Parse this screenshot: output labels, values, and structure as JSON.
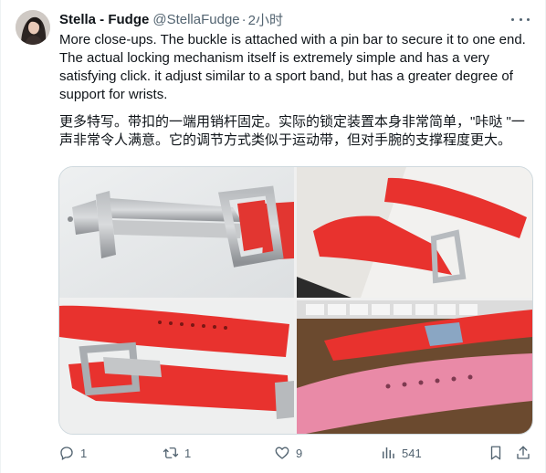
{
  "author": {
    "name": "Stella - Fudge",
    "handle": "@StellaFudge",
    "separator": "·",
    "time": "2小时"
  },
  "tweet": {
    "text_en": "More close-ups. The buckle is attached with a pin bar to secure it to one end. The actual locking mechanism itself is extremely simple and has a very satisfying click. it adjust similar to a sport band, but has a greater degree of support for wrists.",
    "text_zh": "更多特写。带扣的一端用销杆固定。实际的锁定装置本身非常简单，\"咔哒 \"一声非常令人满意。它的调节方式类似于运动带，但对手腕的支撑程度更大。"
  },
  "media": [
    {
      "name": "buckle closeup on white"
    },
    {
      "name": "red band with buckle on box"
    },
    {
      "name": "red band holes and buckle"
    },
    {
      "name": "red and pink bands on keyboard desk"
    }
  ],
  "actions": {
    "reply_count": "1",
    "retweet_count": "1",
    "like_count": "9",
    "views_count": "541"
  },
  "icons": [
    "more-icon",
    "reply-icon",
    "retweet-icon",
    "like-icon",
    "views-icon",
    "bookmark-icon",
    "share-icon"
  ],
  "colors": {
    "text": "#0f1419",
    "secondary": "#536471",
    "border": "#cfd9de",
    "band_red": "#e8322e",
    "band_pink": "#e98aa7"
  }
}
